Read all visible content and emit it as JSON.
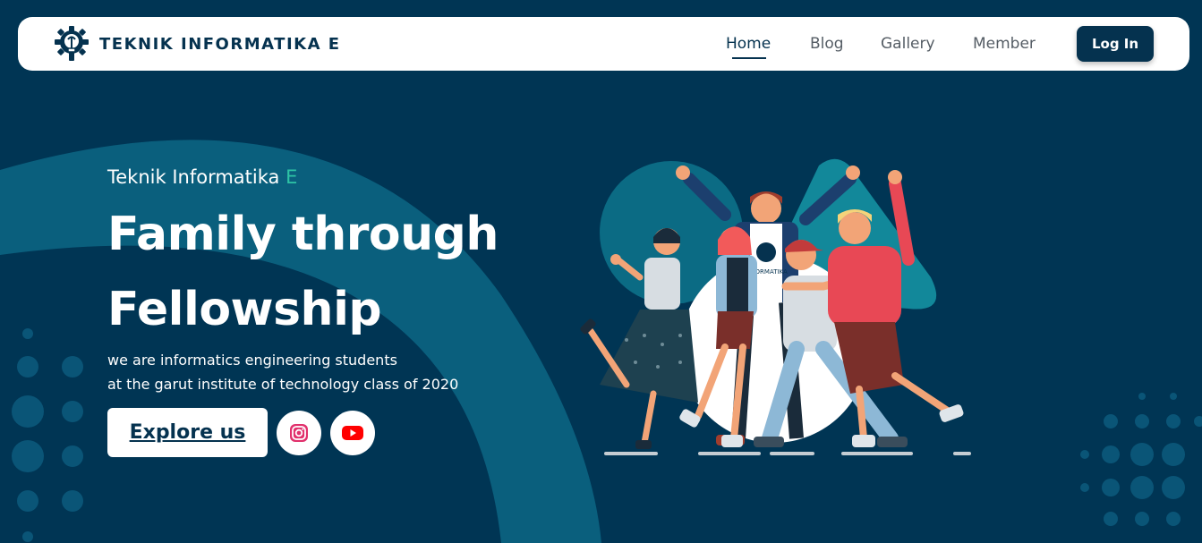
{
  "navbar": {
    "brand": "TEKNIK INFORMATIKA E",
    "links": [
      "Home",
      "Blog",
      "Gallery",
      "Member"
    ],
    "active": "Home",
    "login_label": "Log In"
  },
  "hero": {
    "eyebrow": "Teknik Informatika",
    "eyebrow_accent": "E",
    "headline_line1": "Family through",
    "headline_line2": "Fellowship",
    "description_line1": "we are informatics engineering students",
    "description_line2": "at the garut institute of technology class of 2020",
    "explore_label": "Explore us",
    "social": [
      "instagram-icon",
      "youtube-icon"
    ]
  },
  "illustration": {
    "shirt_text": "INFORMATIKA"
  },
  "colors": {
    "background": "#003554",
    "navy": "#05324f",
    "accent_green": "#2ec4a5",
    "arc_teal": "#0a5f7d",
    "instagram": "#e1306c",
    "youtube": "#ff0000"
  }
}
